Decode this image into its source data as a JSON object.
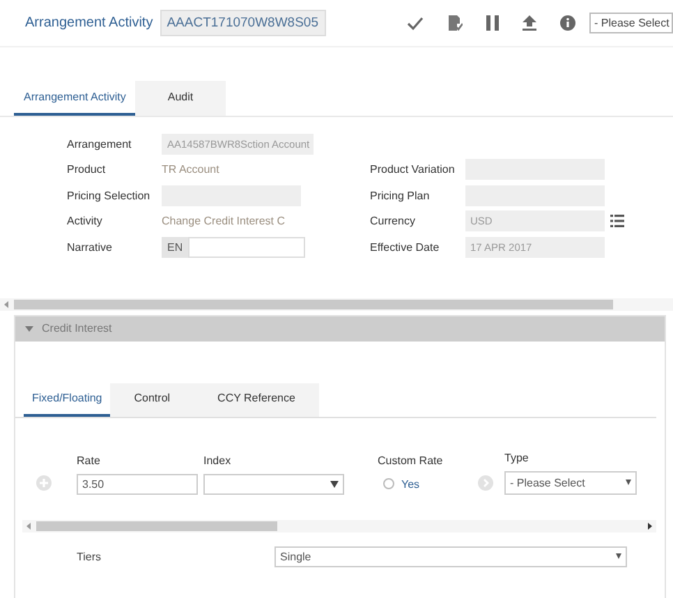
{
  "header": {
    "title": "Arrangement Activity",
    "id": "AAACT171070W8W8S05",
    "select_placeholder": "- Please Select"
  },
  "tabs": [
    {
      "label": "Arrangement Activity",
      "selected": true
    },
    {
      "label": "Audit",
      "selected": false
    }
  ],
  "rows": [
    {
      "left": {
        "label": "Arrangement",
        "kind": "filled",
        "value": "AA14587BWR8Sction Account"
      }
    },
    {
      "left": {
        "label": "Product",
        "kind": "plain",
        "value": "TR Account"
      },
      "right": {
        "label": "Product Variation",
        "kind": "filled"
      }
    },
    {
      "left": {
        "label": "Pricing Selection",
        "kind": "filled"
      },
      "right": {
        "label": "Pricing Plan",
        "kind": "filled"
      }
    },
    {
      "left": {
        "label": "Activity",
        "kind": "plain",
        "value": "Change Credit Interest C"
      },
      "right": {
        "label": "Currency",
        "kind": "filled",
        "value": "USD",
        "lookup": true
      }
    },
    {
      "left": {
        "label": "Narrative",
        "kind": "lang",
        "prefix": "EN"
      },
      "right": {
        "label": "Effective Date",
        "kind": "filled",
        "value": "17 APR 2017"
      }
    }
  ],
  "panel": {
    "title": "Credit Interest",
    "expanded": true,
    "tabs": [
      {
        "label": "Fixed/Floating",
        "selected": true
      },
      {
        "label": "Control",
        "selected": false
      },
      {
        "label": "CCY Reference",
        "selected": false
      }
    ],
    "rate": {
      "label": "Rate",
      "value": "3.50"
    },
    "index": {
      "label": "Index"
    },
    "custom_rate": {
      "label": "Custom Rate",
      "option": "Yes",
      "checked": false
    },
    "type": {
      "label": "Type",
      "value": "- Please Select"
    },
    "tiers": {
      "label": "Tiers",
      "value": "Single"
    }
  }
}
